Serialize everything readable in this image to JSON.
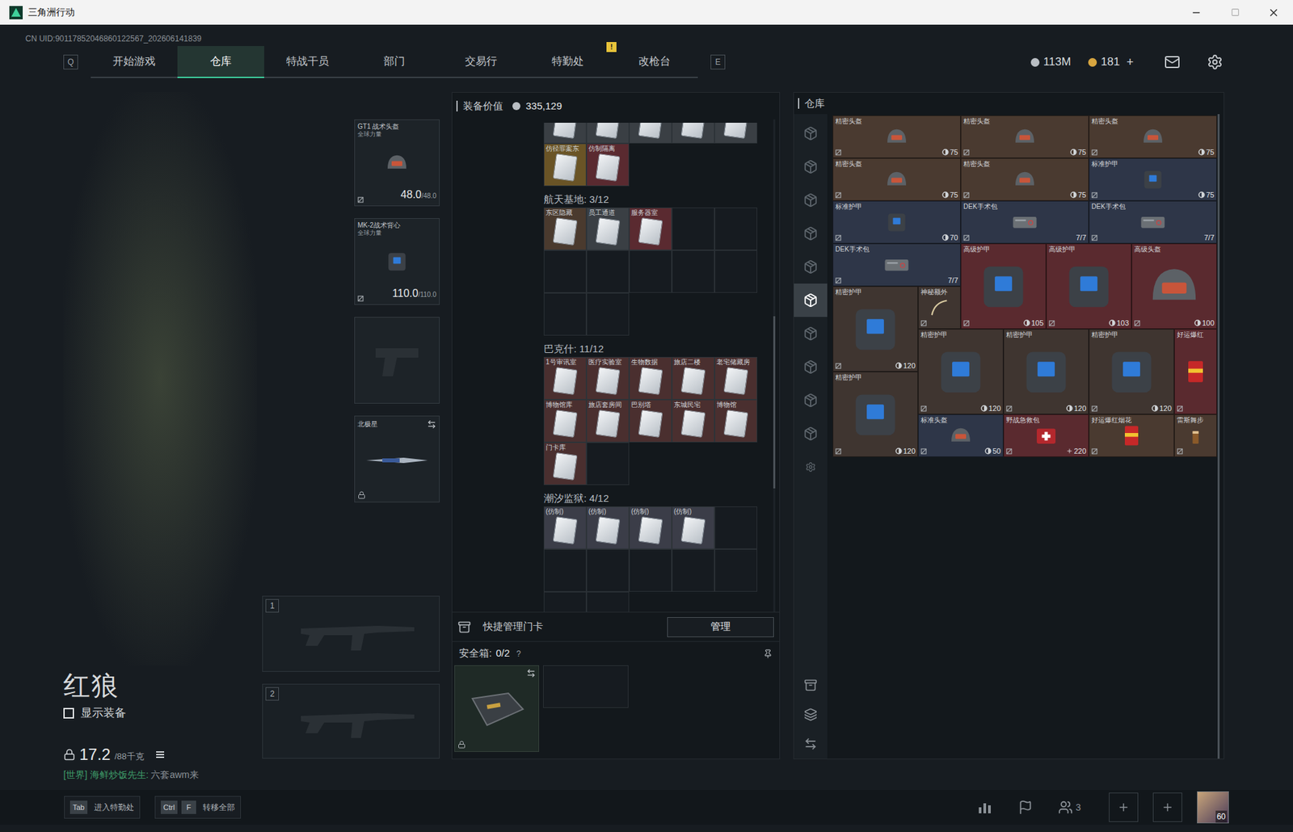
{
  "window": {
    "title": "三角洲行动"
  },
  "uid": "CN UID:90117852046860122567_202606141839",
  "nav": {
    "left_key": "Q",
    "right_key": "E",
    "tabs": [
      {
        "label": "开始游戏",
        "selected": false
      },
      {
        "label": "仓库",
        "selected": true
      },
      {
        "label": "特战干员",
        "selected": false
      },
      {
        "label": "部门",
        "selected": false
      },
      {
        "label": "交易行",
        "selected": false
      },
      {
        "label": "特勤处",
        "selected": false,
        "badge": "!"
      },
      {
        "label": "改枪台",
        "selected": false
      }
    ]
  },
  "currency": [
    {
      "value": "113M",
      "kind": "silver"
    },
    {
      "value": "181",
      "kind": "gold",
      "action": "+"
    }
  ],
  "character": {
    "name": "红狼",
    "show_equipment": {
      "label": "显示装备",
      "checked": false
    },
    "weight": "17.2",
    "weight_max": "/88千克",
    "chat": {
      "channel": "[世界]",
      "sender": "海鲜炒饭先生:",
      "message": "六套awm来"
    }
  },
  "equipment": {
    "helmet": {
      "name": "GT1 战术头盔",
      "tag": "全球力量",
      "durability": "48.0",
      "max": "/48.0"
    },
    "armor": {
      "name": "MK-2战术背心",
      "tag": "全球力量",
      "durability": "110.0",
      "max": "/110.0"
    },
    "melee": {
      "name": "北极星",
      "locked": true
    },
    "weapon_slots": [
      "1",
      "2"
    ]
  },
  "stash": {
    "label": "装备价值",
    "value": "335,129"
  },
  "keycards": {
    "sections": [
      {
        "kind": "partial",
        "slots": 7,
        "cards": [
          {
            "label": "",
            "color": "#3a3f44"
          },
          {
            "label": "",
            "color": "#3a3f44"
          },
          {
            "label": "",
            "color": "#3a3f44"
          },
          {
            "label": "",
            "color": "#3a3f44"
          },
          {
            "label": "",
            "color": "#3a3f44"
          },
          {
            "label": "仿径罪案东",
            "color": "#6a5426"
          },
          {
            "label": "仿制隔离",
            "color": "#5a2a30"
          }
        ]
      },
      {
        "kind": "full",
        "title": "航天基地: 3/12",
        "slots": 12,
        "cards": [
          {
            "label": "东区隐藏",
            "color": "#4a3a2e"
          },
          {
            "label": "员工通道",
            "color": "#3a3f44"
          },
          {
            "label": "服务器室",
            "color": "#5a2a30"
          }
        ]
      },
      {
        "kind": "full",
        "title": "巴克什: 11/12",
        "slots": 12,
        "cards": [
          {
            "label": "1号审讯室",
            "color": "#4a2f2f"
          },
          {
            "label": "医疗实验室",
            "color": "#4a2f2f"
          },
          {
            "label": "生物数据",
            "color": "#4a2f2f"
          },
          {
            "label": "旅店二楼",
            "color": "#4a2f2f"
          },
          {
            "label": "老宅储藏房",
            "color": "#4a2f2f"
          },
          {
            "label": "博物馆库",
            "color": "#4a2f2f"
          },
          {
            "label": "旅店套房间",
            "color": "#4a2f2f"
          },
          {
            "label": "巴别塔",
            "color": "#4a2f2f"
          },
          {
            "label": "东城民宅",
            "color": "#4a2f2f"
          },
          {
            "label": "博物馆",
            "color": "#4a2f2f"
          },
          {
            "label": "门卡库",
            "color": "#4a2f2f"
          }
        ]
      },
      {
        "kind": "full",
        "title": "潮汐监狱: 4/12",
        "slots": 12,
        "cards": [
          {
            "label": "(仿制)",
            "color": "#3b3d48"
          },
          {
            "label": "(仿制)",
            "color": "#3b3d48"
          },
          {
            "label": "(仿制)",
            "color": "#3b3d48"
          },
          {
            "label": "(仿制)",
            "color": "#3b3d48"
          }
        ]
      }
    ],
    "quick_manage": {
      "label": "快捷管理门卡",
      "button": "管理"
    },
    "safe_box": {
      "label": "安全箱:",
      "value": "0/2",
      "help": "?",
      "locked": true
    }
  },
  "warehouse": {
    "title": "仓库",
    "categories": [
      {
        "selected": false
      },
      {
        "selected": false
      },
      {
        "selected": false
      },
      {
        "selected": false
      },
      {
        "selected": false
      },
      {
        "selected": true
      },
      {
        "selected": false
      },
      {
        "selected": false
      },
      {
        "selected": false
      },
      {
        "selected": false
      }
    ],
    "items": [
      {
        "name": "精密头盔",
        "value": "75",
        "kind": "helmet",
        "color": "#4a3a30"
      },
      {
        "name": "精密头盔",
        "value": "75",
        "kind": "helmet",
        "color": "#4a3a30"
      },
      {
        "name": "精密头盔",
        "value": "75",
        "kind": "helmet",
        "color": "#4a3a30"
      },
      {
        "name": "精密头盔",
        "value": "75",
        "kind": "helmet",
        "color": "#4a3a30"
      },
      {
        "name": "精密头盔",
        "value": "75",
        "kind": "helmet",
        "color": "#4a3a30"
      },
      {
        "name": "标准护甲",
        "value": "75",
        "kind": "armor",
        "color": "#2e3648"
      },
      {
        "name": "标准护甲",
        "value": "70",
        "kind": "armor",
        "color": "#2e3648"
      },
      {
        "name": "DEK手术包",
        "value": "7/7",
        "kind": "dek",
        "color": "#2e3648"
      },
      {
        "name": "DEK手术包",
        "value": "7/7",
        "kind": "dek",
        "color": "#2e3648"
      },
      {
        "name": "DEK手术包",
        "value": "7/7",
        "kind": "dek",
        "color": "#2e3648"
      },
      {
        "name": "高级护甲",
        "value": "105",
        "kind": "armor",
        "color": "#5a2a2f"
      },
      {
        "name": "高级护甲",
        "value": "103",
        "kind": "armor",
        "color": "#5a2a2f"
      },
      {
        "name": "高级头盔",
        "value": "100",
        "kind": "helmet",
        "color": "#5a2a2f"
      },
      {
        "name": "精密护甲",
        "value": "120",
        "kind": "armor",
        "color": "#3f3530"
      },
      {
        "name": "神秘额外",
        "kind": "misc",
        "color": "#3f3530"
      },
      {
        "name": "精密护甲",
        "value": "120",
        "kind": "armor",
        "color": "#3f3530"
      },
      {
        "name": "精密护甲",
        "value": "120",
        "kind": "armor",
        "color": "#3f3530"
      },
      {
        "name": "精密护甲",
        "value": "120",
        "kind": "armor",
        "color": "#3f3530"
      },
      {
        "name": "好运爆红",
        "kind": "firework",
        "color": "#5a2a2f"
      },
      {
        "name": "精密护甲",
        "value": "120",
        "kind": "armor",
        "color": "#3f3530"
      },
      {
        "name": "标准头盔",
        "value": "50",
        "kind": "helmet",
        "color": "#2e3648"
      },
      {
        "name": "野战急救包",
        "value": "220",
        "kind": "heal",
        "color": "#5a2a2f"
      },
      {
        "name": "好运爆红烟花",
        "kind": "firework",
        "color": "#4a3a30"
      },
      {
        "name": "雷斯舞步",
        "kind": "drink",
        "color": "#4a3a30"
      }
    ]
  },
  "bottom": {
    "hints": [
      {
        "keys": [
          "Tab"
        ],
        "label": "进入特勤处"
      },
      {
        "keys": [
          "Ctrl",
          "F"
        ],
        "label": "转移全部"
      }
    ],
    "friends": "3",
    "level": "60"
  }
}
